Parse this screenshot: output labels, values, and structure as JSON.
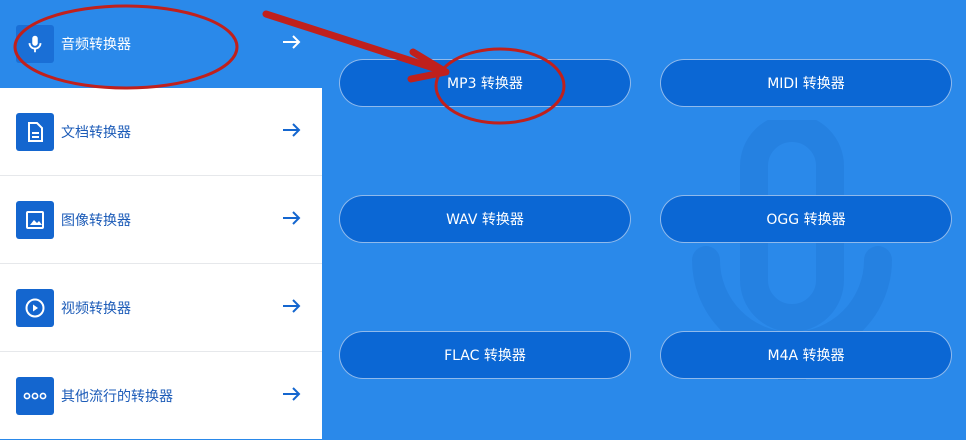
{
  "sidebar": {
    "items": [
      {
        "label": "音频转换器",
        "icon": "microphone-icon",
        "active": true
      },
      {
        "label": "文档转换器",
        "icon": "document-icon",
        "active": false
      },
      {
        "label": "图像转换器",
        "icon": "image-icon",
        "active": false
      },
      {
        "label": "视频转换器",
        "icon": "play-icon",
        "active": false
      },
      {
        "label": "其他流行的转换器",
        "icon": "more-dots-icon",
        "active": false
      }
    ]
  },
  "main": {
    "buttons": [
      {
        "label": "MP3 转换器"
      },
      {
        "label": "MIDI 转换器"
      },
      {
        "label": "WAV 转换器"
      },
      {
        "label": "OGG 转换器"
      },
      {
        "label": "FLAC 转换器"
      },
      {
        "label": "M4A 转换器"
      }
    ],
    "background_icon": "microphone-icon"
  },
  "colors": {
    "panel_blue": "#2a89ea",
    "button_blue": "#0b67d4",
    "icon_tile": "#1466cf",
    "sidebar_text": "#1d5cb8",
    "annotation_red": "#c0201c"
  }
}
